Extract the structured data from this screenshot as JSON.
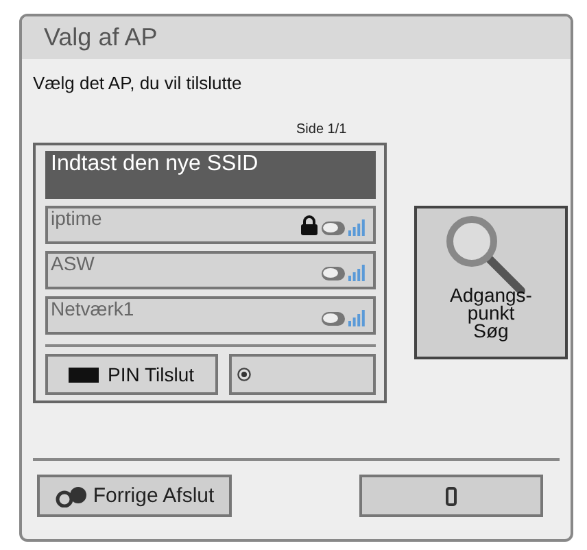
{
  "window": {
    "title": "Valg af AP"
  },
  "prompt": "Vælg det AP, du vil tilslutte",
  "page": "Side 1/1",
  "ssid_entry": {
    "label": "Indtast den nye SSID",
    "selected": true
  },
  "networks": [
    {
      "name": "iptime",
      "locked": true,
      "selected": false
    },
    {
      "name": "ASW",
      "locked": false,
      "selected": false
    },
    {
      "name": "Netværk1",
      "locked": false,
      "selected": false
    }
  ],
  "pin_button": {
    "label": "PIN Tilslut"
  },
  "search_button": {
    "lines": [
      "Adgangs-",
      "punkt",
      "Søg"
    ]
  },
  "bottom_button": {
    "label": "Forrige Afslut"
  }
}
